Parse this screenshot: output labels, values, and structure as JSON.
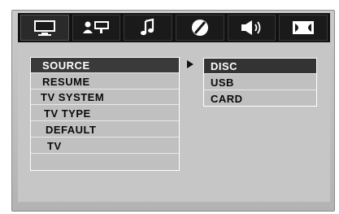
{
  "tabs": [
    {
      "icon": "monitor-icon",
      "active": true
    },
    {
      "icon": "user-speaker-icon",
      "active": false
    },
    {
      "icon": "music-note-icon",
      "active": false
    },
    {
      "icon": "disc-slash-icon",
      "active": false
    },
    {
      "icon": "speaker-volume-icon",
      "active": false
    },
    {
      "icon": "dolby-icon",
      "active": false
    }
  ],
  "menu": {
    "items": [
      "SOURCE",
      "RESUME",
      "TV SYSTEM",
      "TV TYPE",
      "DEFAULT",
      "TV"
    ],
    "selected": "SOURCE"
  },
  "submenu": {
    "items": [
      "DISC",
      "USB",
      "CARD"
    ],
    "selected": "DISC"
  },
  "colors": {
    "background": "#c6c6c6",
    "tab_bar": "#111111",
    "highlight": "#333333",
    "text": "#0a0a0a"
  }
}
